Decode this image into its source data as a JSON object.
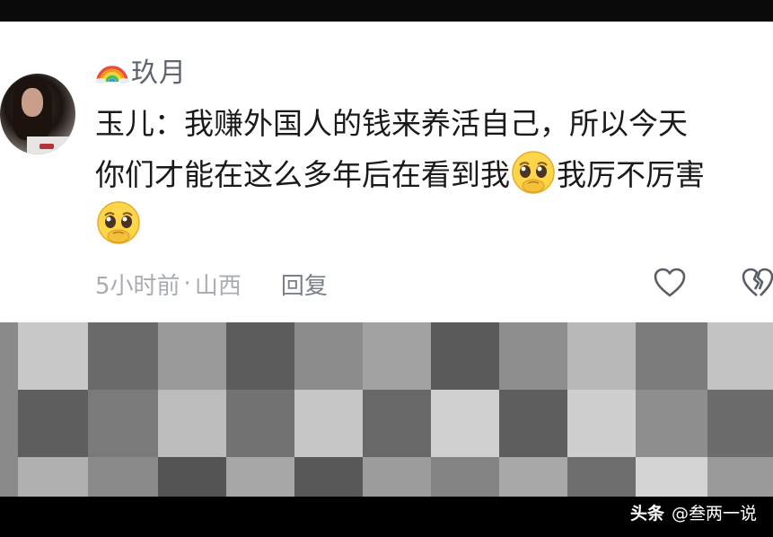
{
  "comment": {
    "username": "玖月",
    "username_icon": "rainbow-icon",
    "lines": [
      "玉儿：我赚外国人的钱来养活自己，所以今天",
      "你们才能在这么多年后在看到我",
      "我厉不厉害"
    ],
    "emoji": "pleading-face-icon",
    "time": "5小时前",
    "separator": "·",
    "location": "山西",
    "reply_label": "回复"
  },
  "watermark": {
    "logo_text": "头条",
    "account": "@叁两一说"
  },
  "colors": {
    "card_bg": "#ffffff",
    "text": "#1a1a1a",
    "meta": "#a8acb3",
    "username": "#5f6470",
    "frame": "#000000"
  }
}
